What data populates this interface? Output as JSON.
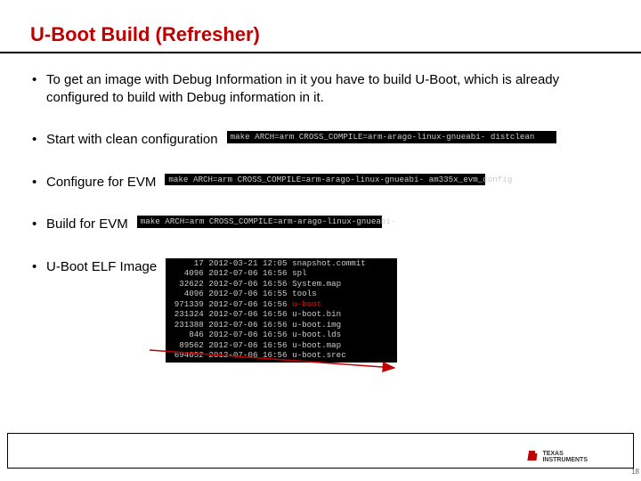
{
  "title": "U-Boot Build (Refresher)",
  "bullets": {
    "intro": "To get an image with Debug Information in it you have to build U-Boot, which is already configured to build with Debug information in it.",
    "clean": "Start with clean configuration",
    "configure": "Configure for EVM",
    "build": "Build for EVM",
    "elf": "U-Boot ELF Image"
  },
  "terminal": {
    "clean": "make ARCH=arm CROSS_COMPILE=arm-arago-linux-gnueabi- distclean",
    "configure": "make ARCH=arm CROSS_COMPILE=arm-arago-linux-gnueabi- am335x_evm_config",
    "build": "make ARCH=arm CROSS_COMPILE=arm-arago-linux-gnueabi-"
  },
  "listing": [
    {
      "size": "17",
      "date": "2012-03-21 12:05",
      "name": "snapshot.commit",
      "hl": false
    },
    {
      "size": "4096",
      "date": "2012-07-06 16:56",
      "name": "spl",
      "hl": false
    },
    {
      "size": "32622",
      "date": "2012-07-06 16:56",
      "name": "System.map",
      "hl": false
    },
    {
      "size": "4096",
      "date": "2012-07-06 16:55",
      "name": "tools",
      "hl": false
    },
    {
      "size": "971339",
      "date": "2012-07-06 16:56",
      "name": "u-boot",
      "hl": true
    },
    {
      "size": "231324",
      "date": "2012-07-06 16:56",
      "name": "u-boot.bin",
      "hl": false
    },
    {
      "size": "231388",
      "date": "2012-07-06 16:56",
      "name": "u-boot.img",
      "hl": false
    },
    {
      "size": "846",
      "date": "2012-07-06 16:56",
      "name": "u-boot.lds",
      "hl": false
    },
    {
      "size": "89562",
      "date": "2012-07-06 16:56",
      "name": "u-boot.map",
      "hl": false
    },
    {
      "size": "694052",
      "date": "2012-07-06 16:56",
      "name": "u-boot.srec",
      "hl": false
    }
  ],
  "footer": {
    "brand_line1": "TEXAS",
    "brand_line2": "INSTRUMENTS",
    "page": "18"
  }
}
